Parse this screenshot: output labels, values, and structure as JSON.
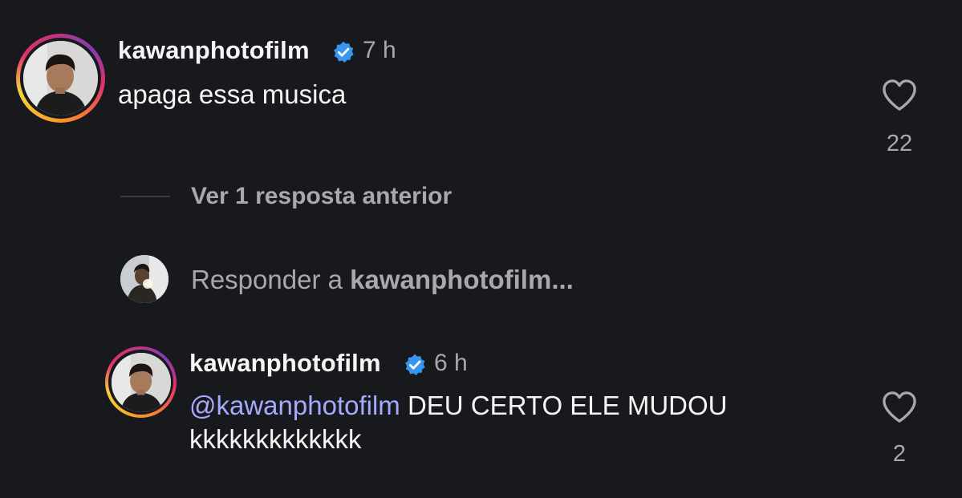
{
  "comments": [
    {
      "username": "kawanphotofilm",
      "verified": true,
      "time": "7 h",
      "text": "apaga essa musica",
      "likes": "22"
    },
    {
      "username": "kawanphotofilm",
      "verified": true,
      "time": "6 h",
      "mention": "@kawanphotofilm",
      "text_line1": " DEU CERTO ELE MUDOU",
      "text_line2": "kkkkkkkkkkkkk",
      "likes": "2"
    }
  ],
  "view_replies_label": "Ver 1 resposta anterior",
  "reply_prompt": {
    "prefix": "Responder a ",
    "target": "kawanphotofilm...",
    "ellipsis": ""
  },
  "colors": {
    "background": "#18191d",
    "text": "#f5f5f5",
    "muted": "#a8a8ad",
    "mention": "#a6aaff",
    "verified": "#3797f0"
  },
  "icons": [
    "verified-badge-icon",
    "heart-icon"
  ]
}
